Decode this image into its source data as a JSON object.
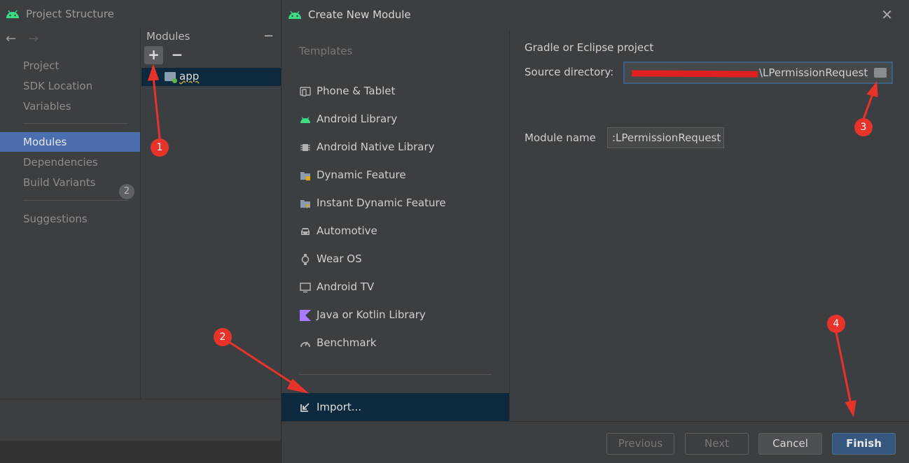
{
  "project_structure": {
    "title": "Project Structure",
    "nav_back": "←",
    "nav_forward": "→",
    "nav_items": [
      "Project",
      "SDK Location",
      "Variables",
      "Modules",
      "Dependencies",
      "Build Variants",
      "Suggestions"
    ],
    "selected_item": "Modules",
    "suggestions_count": "2",
    "modules_header": "Modules",
    "add_symbol": "+",
    "remove_symbol": "−",
    "collapse_symbol": "−",
    "module_app": "app"
  },
  "dialog": {
    "title": "Create New Module",
    "close_symbol": "✕",
    "templates_header": "Templates",
    "templates": [
      {
        "label": "Phone & Tablet",
        "icon": "phone-tablet-icon"
      },
      {
        "label": "Android Library",
        "icon": "android-icon"
      },
      {
        "label": "Android Native Library",
        "icon": "chip-icon"
      },
      {
        "label": "Dynamic Feature",
        "icon": "folder-feature-icon"
      },
      {
        "label": "Instant Dynamic Feature",
        "icon": "folder-lightning-icon"
      },
      {
        "label": "Automotive",
        "icon": "car-icon"
      },
      {
        "label": "Wear OS",
        "icon": "watch-icon"
      },
      {
        "label": "Android TV",
        "icon": "tv-icon"
      },
      {
        "label": "Java or Kotlin Library",
        "icon": "kotlin-icon"
      },
      {
        "label": "Benchmark",
        "icon": "gauge-icon"
      }
    ],
    "import_label": "Import...",
    "section_title": "Gradle or Eclipse project",
    "source_dir_label": "Source directory:",
    "source_dir_value": "\\LPermissionRequest",
    "module_name_label": "Module name",
    "module_name_value": ":LPermissionRequest",
    "buttons": {
      "previous": "Previous",
      "next": "Next",
      "cancel": "Cancel",
      "finish": "Finish"
    }
  },
  "annotations": [
    "1",
    "2",
    "3",
    "4"
  ],
  "colors": {
    "accent_selected": "#4b6eaf",
    "annotation_red": "#e8332b",
    "finish_blue": "#365880",
    "android_green": "#3ddc84"
  }
}
